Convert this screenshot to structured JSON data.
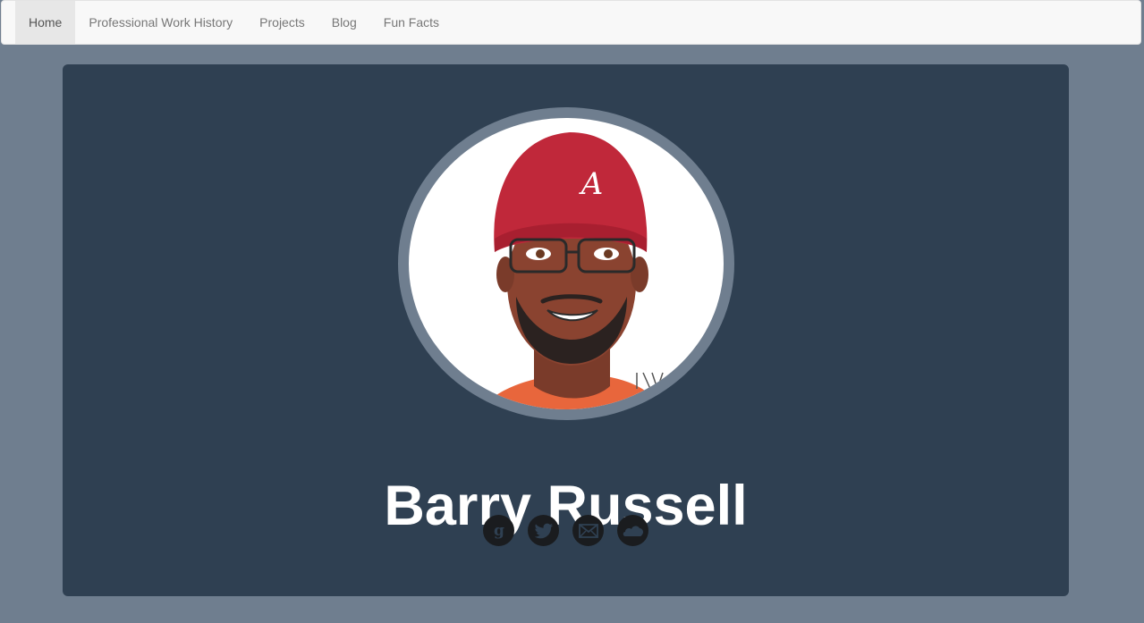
{
  "nav": {
    "items": [
      {
        "label": "Home",
        "active": true
      },
      {
        "label": "Professional Work History",
        "active": false
      },
      {
        "label": "Projects",
        "active": false
      },
      {
        "label": "Blog",
        "active": false
      },
      {
        "label": "Fun Facts",
        "active": false
      }
    ]
  },
  "profile": {
    "name": "Barry Russell",
    "avatar_alt": "Illustrated portrait of a man in a red beanie with glasses and a beard",
    "socials": [
      {
        "icon": "goodreads-icon"
      },
      {
        "icon": "twitter-icon"
      },
      {
        "icon": "email-icon"
      },
      {
        "icon": "soundcloud-icon"
      }
    ]
  },
  "colors": {
    "page_bg": "#6f7e8f",
    "panel_bg": "#2f4052",
    "navbar_bg": "#f8f8f8",
    "active_tab_bg": "#e7e7e7",
    "social_bg": "#1a1c1f"
  }
}
